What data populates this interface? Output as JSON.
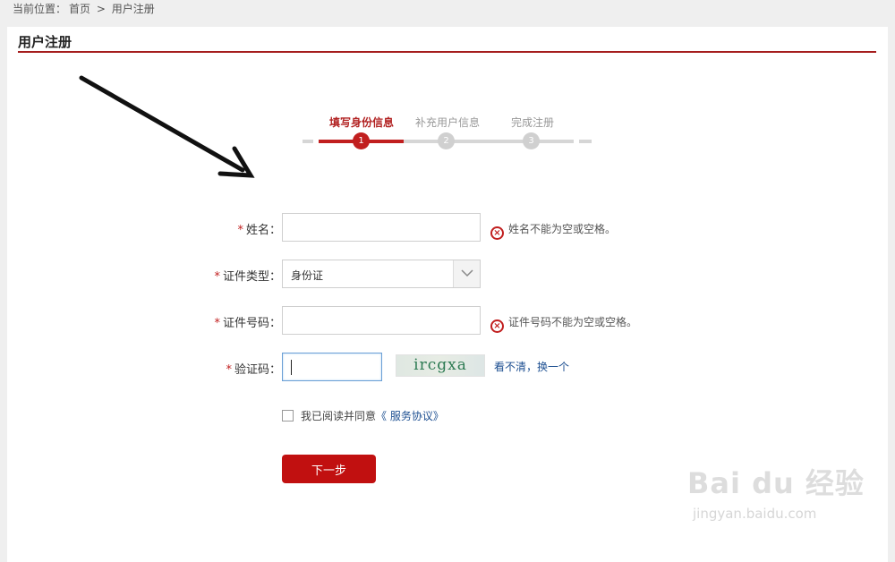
{
  "breadcrumb": {
    "prefix": "当前位置：",
    "home": "首页",
    "separator": ">",
    "current": "用户注册"
  },
  "page_title": "用户注册",
  "steps": [
    {
      "label": "填写身份信息",
      "number": "1",
      "active": true
    },
    {
      "label": "补充用户信息",
      "number": "2",
      "active": false
    },
    {
      "label": "完成注册",
      "number": "3",
      "active": false
    }
  ],
  "form": {
    "required_mark": "*",
    "name": {
      "label": "姓名：",
      "value": "",
      "error": "姓名不能为空或空格。"
    },
    "id_type": {
      "label": "证件类型：",
      "selected": "身份证"
    },
    "id_number": {
      "label": "证件号码：",
      "value": "",
      "error": "证件号码不能为空或空格。"
    },
    "captcha": {
      "label": "验证码：",
      "value": "",
      "image_text": "ircgxa",
      "refresh_link": "看不清，换一个"
    },
    "agreement": {
      "text": "我已阅读并同意",
      "link": "《 服务协议》",
      "checked": false
    },
    "next_button": "下一步"
  },
  "icons": {
    "error": "error-circle-x-icon",
    "dropdown": "chevron-down-icon",
    "arrow": "annotation-arrow-icon"
  },
  "colors": {
    "accent": "#c11f1f",
    "link": "#1d4f91",
    "title_rule": "#a51d1d"
  },
  "watermark": {
    "main": "Bai du 经验",
    "sub": "jingyan.baidu.com"
  }
}
